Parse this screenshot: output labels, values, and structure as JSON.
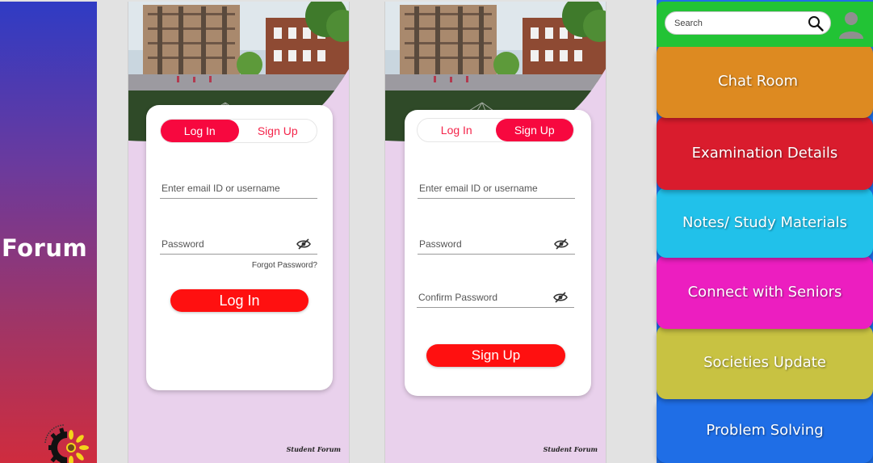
{
  "splash": {
    "title": "Forum"
  },
  "login_screen": {
    "tabs": [
      {
        "label": "Log In",
        "active": true
      },
      {
        "label": "Sign Up",
        "active": false
      }
    ],
    "email_placeholder": "Enter email ID or username",
    "password_placeholder": "Password",
    "forgot_label": "Forgot Password?",
    "submit_label": "Log In",
    "footer": "Student Forum"
  },
  "signup_screen": {
    "tabs": [
      {
        "label": "Log In",
        "active": false
      },
      {
        "label": "Sign Up",
        "active": true
      }
    ],
    "email_placeholder": "Enter email ID or username",
    "password_placeholder": "Password",
    "confirm_placeholder": "Confirm Password",
    "submit_label": "Sign Up",
    "footer": "Student Forum"
  },
  "menu_screen": {
    "search_placeholder": "Search",
    "tiles": [
      {
        "label": "Chat Room",
        "color": "#dd8a21"
      },
      {
        "label": "Examination Details",
        "color": "#d91c2d"
      },
      {
        "label": "Notes/ Study Materials",
        "color": "#21c1ea"
      },
      {
        "label": "Connect with Seniors",
        "color": "#ec1ec0"
      },
      {
        "label": "Societies Update",
        "color": "#c8c242"
      },
      {
        "label": "Problem Solving",
        "color": "#1f6ee6"
      }
    ]
  },
  "colors": {
    "accent": "#f7083f",
    "button": "#ff1010",
    "topbar": "#22c335",
    "phone_bg": "#e9d1ec"
  },
  "icons": [
    "eye-slash-icon",
    "search-icon",
    "user-avatar-icon",
    "college-logo-icon"
  ]
}
